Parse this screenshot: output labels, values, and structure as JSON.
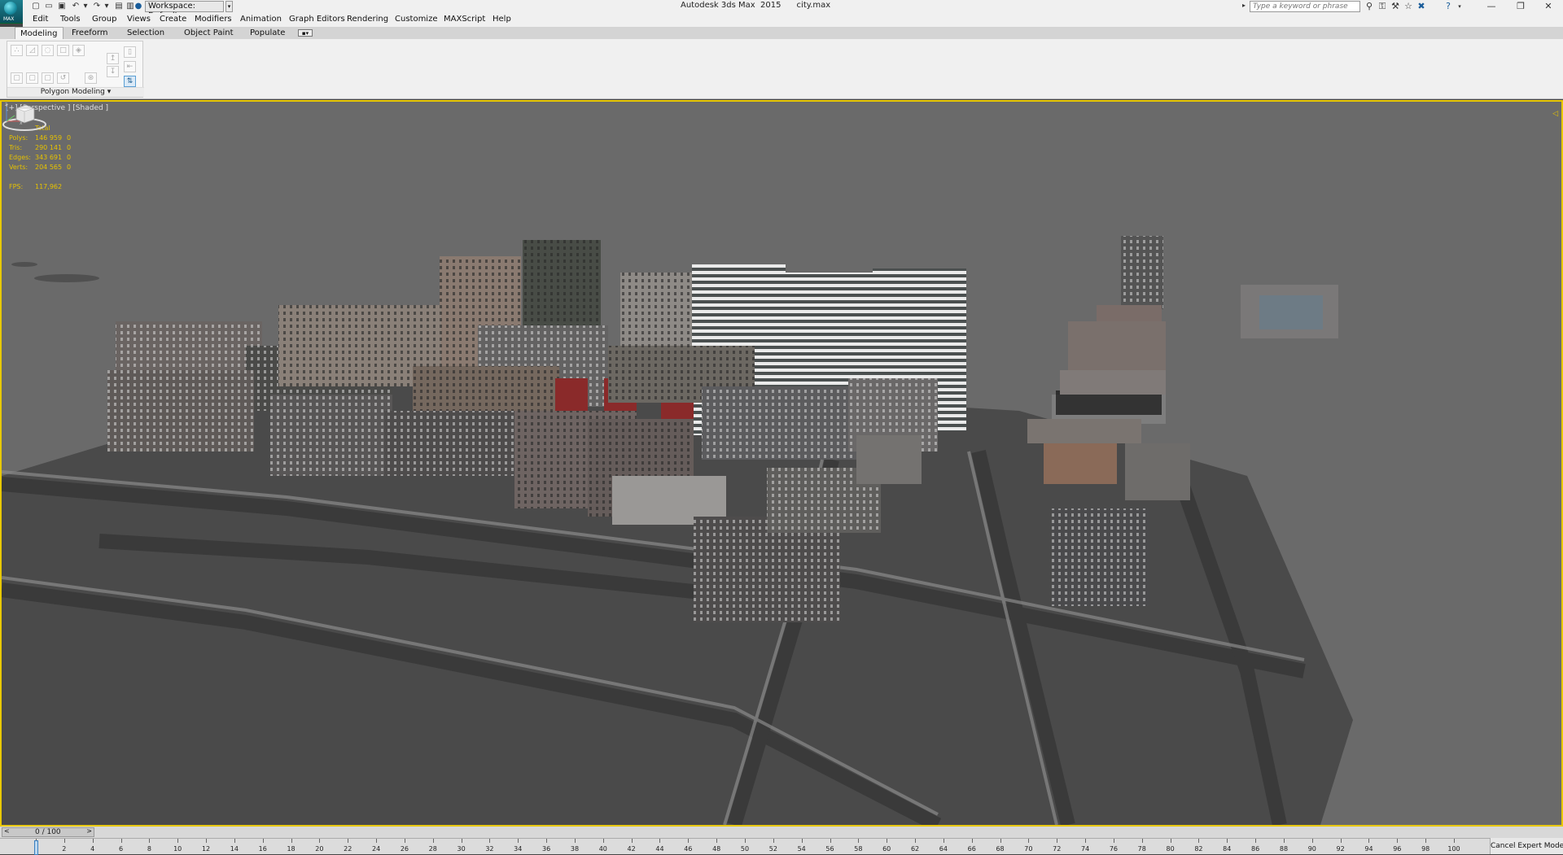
{
  "title_bar": {
    "app_title": "Autodesk 3ds Max  2015      city.max",
    "workspace_label": "Workspace: Default",
    "search_placeholder": "Type a keyword or phrase",
    "logo_text": "MAX"
  },
  "menu": {
    "items": [
      "Edit",
      "Tools",
      "Group",
      "Views",
      "Create",
      "Modifiers",
      "Animation",
      "Graph Editors",
      "Rendering",
      "Customize",
      "MAXScript",
      "Help"
    ]
  },
  "ribbon": {
    "tabs": [
      "Modeling",
      "Freeform",
      "Selection",
      "Object Paint",
      "Populate"
    ],
    "active_tab": "Modeling",
    "panel_label": "Polygon Modeling ▾"
  },
  "viewport": {
    "label": "[+] [Perspective ] [Shaded ]",
    "stats_header": "Total",
    "stats": [
      {
        "label": "Polys:",
        "total": "146 959",
        "selected": "0"
      },
      {
        "label": "Tris:",
        "total": "290 141",
        "selected": "0"
      },
      {
        "label": "Edges:",
        "total": "343 691",
        "selected": "0"
      },
      {
        "label": "Verts:",
        "total": "204 565",
        "selected": "0"
      }
    ],
    "fps_label": "FPS:",
    "fps_value": "117,962"
  },
  "timeline": {
    "slider_label": "0 / 100",
    "ticks": [
      "0",
      "2",
      "4",
      "6",
      "8",
      "10",
      "12",
      "14",
      "16",
      "18",
      "20",
      "22",
      "24",
      "26",
      "28",
      "30",
      "32",
      "34",
      "36",
      "38",
      "40",
      "42",
      "44",
      "46",
      "48",
      "50",
      "52",
      "54",
      "56",
      "58",
      "60",
      "62",
      "64",
      "66",
      "68",
      "70",
      "72",
      "74",
      "76",
      "78",
      "80",
      "82",
      "84",
      "86",
      "88",
      "90",
      "92",
      "94",
      "96",
      "98",
      "100"
    ],
    "cancel_label": "Cancel Expert Mode"
  },
  "colors": {
    "viewport_bg": "#6a6a6a",
    "active_border": "#e8c800",
    "stats_color": "#e6c200",
    "ui_bg": "#f0f0f0"
  },
  "icons": [
    "new-file-icon",
    "open-file-icon",
    "save-icon",
    "undo-icon",
    "redo-icon",
    "project-icon",
    "binoculars-icon",
    "tools-icon",
    "star-icon",
    "close-x-icon",
    "help-icon",
    "minimize-icon",
    "restore-icon",
    "close-icon",
    "viewcube-icon",
    "axis-tripod-icon"
  ]
}
